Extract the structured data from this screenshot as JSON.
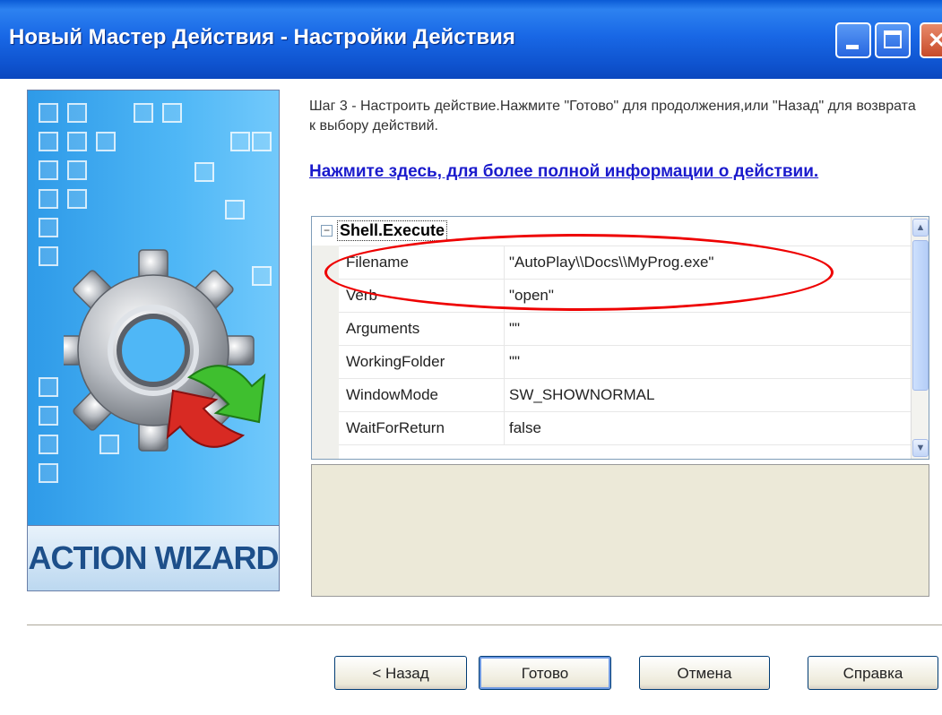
{
  "window": {
    "title": "Новый Мастер Действия - Настройки Действия"
  },
  "banner": {
    "label": "ACTION WIZARD"
  },
  "step_text": "Шаг 3 - Настроить действие.Нажмите \"Готово\" для продолжения,или \"Назад\" для возврата к выбору действий.",
  "help_link": "Нажмите здесь, для более полной информации о действии.",
  "property_grid": {
    "category": "Shell.Execute",
    "rows": [
      {
        "name": "Filename",
        "value": "\"AutoPlay\\\\Docs\\\\MyProg.exe\""
      },
      {
        "name": "Verb",
        "value": "\"open\""
      },
      {
        "name": "Arguments",
        "value": "\"\""
      },
      {
        "name": "WorkingFolder",
        "value": "\"\""
      },
      {
        "name": "WindowMode",
        "value": "SW_SHOWNORMAL"
      },
      {
        "name": "WaitForReturn",
        "value": "false"
      }
    ]
  },
  "buttons": {
    "back": "< Назад",
    "finish": "Готово",
    "cancel": "Отмена",
    "help": "Справка"
  },
  "colors": {
    "titlebar": "#1968e6",
    "banner": "#4fb7f6",
    "link": "#1a1acc",
    "highlight_ellipse": "#e00000"
  }
}
